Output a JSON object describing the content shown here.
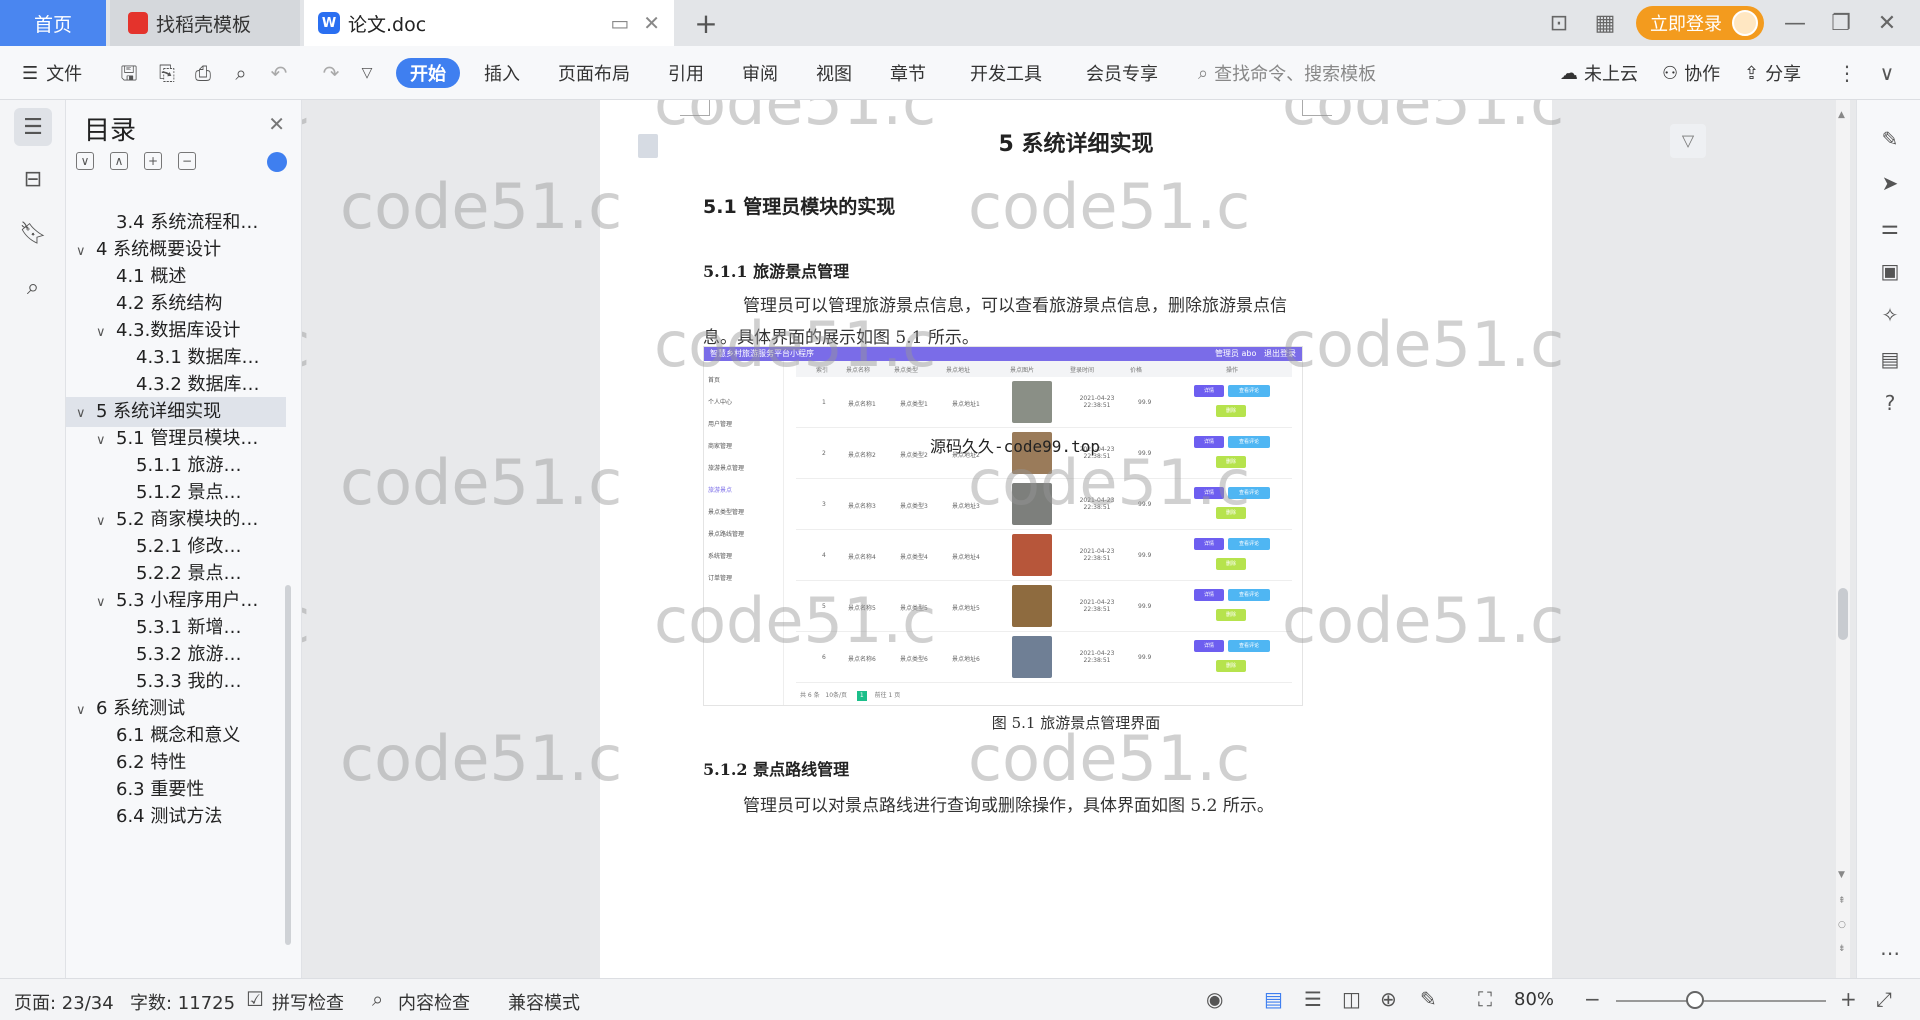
{
  "tabs": {
    "home": "首页",
    "daoke": "找稻壳模板",
    "doc": "论文.doc",
    "add": "+"
  },
  "top_right": {
    "login": "立即登录"
  },
  "toolbar": {
    "file": "文件",
    "start": "开始",
    "insert": "插入",
    "layout": "页面布局",
    "reference": "引用",
    "review": "审阅",
    "view": "视图",
    "chapter": "章节",
    "devtools": "开发工具",
    "member": "会员专享",
    "search": "查找命令、搜索模板",
    "cloud": "未上云",
    "collab": "协作",
    "share": "分享"
  },
  "outline": {
    "title": "目录",
    "items": [
      {
        "text": "3.4 系统流程和…",
        "level": 2,
        "chev": ""
      },
      {
        "text": "4 系统概要设计",
        "level": 1,
        "chev": "∨"
      },
      {
        "text": "4.1 概述",
        "level": 2,
        "chev": ""
      },
      {
        "text": "4.2 系统结构",
        "level": 2,
        "chev": ""
      },
      {
        "text": "4.3.数据库设计",
        "level": 2,
        "chev": "∨"
      },
      {
        "text": "4.3.1 数据库…",
        "level": 3,
        "chev": ""
      },
      {
        "text": "4.3.2 数据库…",
        "level": 3,
        "chev": ""
      },
      {
        "text": "5 系统详细实现",
        "level": 1,
        "chev": "∨"
      },
      {
        "text": "5.1 管理员模块…",
        "level": 2,
        "chev": "∨"
      },
      {
        "text": "5.1.1 旅游…",
        "level": 3,
        "chev": ""
      },
      {
        "text": "5.1.2 景点…",
        "level": 3,
        "chev": ""
      },
      {
        "text": "5.2 商家模块的…",
        "level": 2,
        "chev": "∨"
      },
      {
        "text": "5.2.1 修改…",
        "level": 3,
        "chev": ""
      },
      {
        "text": "5.2.2 景点…",
        "level": 3,
        "chev": ""
      },
      {
        "text": "5.3 小程序用户…",
        "level": 2,
        "chev": "∨"
      },
      {
        "text": "5.3.1 新增…",
        "level": 3,
        "chev": ""
      },
      {
        "text": "5.3.2 旅游…",
        "level": 3,
        "chev": ""
      },
      {
        "text": "5.3.3 我的…",
        "level": 3,
        "chev": ""
      },
      {
        "text": "6 系统测试",
        "level": 1,
        "chev": "∨"
      },
      {
        "text": "6.1 概念和意义",
        "level": 2,
        "chev": ""
      },
      {
        "text": "6.2 特性",
        "level": 2,
        "chev": ""
      },
      {
        "text": "6.3 重要性",
        "level": 2,
        "chev": ""
      },
      {
        "text": "6.4 测试方法",
        "level": 2,
        "chev": ""
      }
    ],
    "selected_index": 7
  },
  "document": {
    "chapter_title": "5 系统详细实现",
    "section": "5.1  管理员模块的实现",
    "subsection1": "5.1.1  旅游景点管理",
    "paragraph": "管理员可以管理旅游景点信息，可以查看旅游景点信息，删除旅游景点信息。具体界面的展示如图 5.1 所示。",
    "caption": "图 5.1  旅游景点管理界面",
    "subsection2": "5.1.2  景点路线管理",
    "next_para": "管理员可以对景点路线进行查询或删除操作，具体界面如图 5.2 所示。"
  },
  "screenshot": {
    "title": "智慧乡村旅游服务平台小程序",
    "user": "管理员 abo",
    "logout": "退出登录",
    "menu": [
      "首页",
      "个人中心",
      "用户管理",
      "商家管理",
      "旅游景点管理",
      "旅游景点",
      "景点类型管理",
      "景点路线管理",
      "系统管理",
      "订单管理"
    ],
    "headers": [
      "索引",
      "景点名称",
      "景点类型",
      "景点地址",
      "景点图片",
      "登录时间",
      "价格",
      "操作"
    ],
    "rows": [
      {
        "idx": "1",
        "name": "景点名称1",
        "type": "景点类型1",
        "addr": "景点地址1",
        "time": "2021-04-23 22:38:51",
        "price": "99.9"
      },
      {
        "idx": "2",
        "name": "景点名称2",
        "type": "景点类型2",
        "addr": "景点地址2",
        "time": "2021-04-23 22:38:51",
        "price": "99.9"
      },
      {
        "idx": "3",
        "name": "景点名称3",
        "type": "景点类型3",
        "addr": "景点地址3",
        "time": "2021-04-23 22:38:51",
        "price": "99.9"
      },
      {
        "idx": "4",
        "name": "景点名称4",
        "type": "景点类型4",
        "addr": "景点地址4",
        "time": "2021-04-23 22:38:51",
        "price": "99.9"
      },
      {
        "idx": "5",
        "name": "景点名称5",
        "type": "景点类型5",
        "addr": "景点地址5",
        "time": "2021-04-23 22:38:51",
        "price": "99.9"
      },
      {
        "idx": "6",
        "name": "景点名称6",
        "type": "景点类型6",
        "addr": "景点地址6",
        "time": "2021-04-23 22:38:51",
        "price": "99.9"
      }
    ],
    "btn_detail": "详情",
    "btn_review": "查看评论",
    "btn_delete": "删除",
    "footer": "共 6 条",
    "page_size": "10条/页",
    "page": "1",
    "goto": "前往",
    "goto_page": "1",
    "page_unit": "页",
    "thumb_colors": [
      "#8a8f86",
      "#9a7b5a",
      "#7d7f7c",
      "#b7563a",
      "#8e6b3f",
      "#6f7f95"
    ],
    "overlay": "源码久久-code99.top"
  },
  "statusbar": {
    "page": "页面: 23/34",
    "words": "字数: 11725",
    "spell": "拼写检查",
    "content": "内容检查",
    "compat": "兼容模式",
    "zoom": "80%"
  },
  "watermark": "code51.c",
  "colors": {
    "accent": "#3f7ff0",
    "login": "#f39b1e",
    "shot_header": "#7a6ce8"
  }
}
